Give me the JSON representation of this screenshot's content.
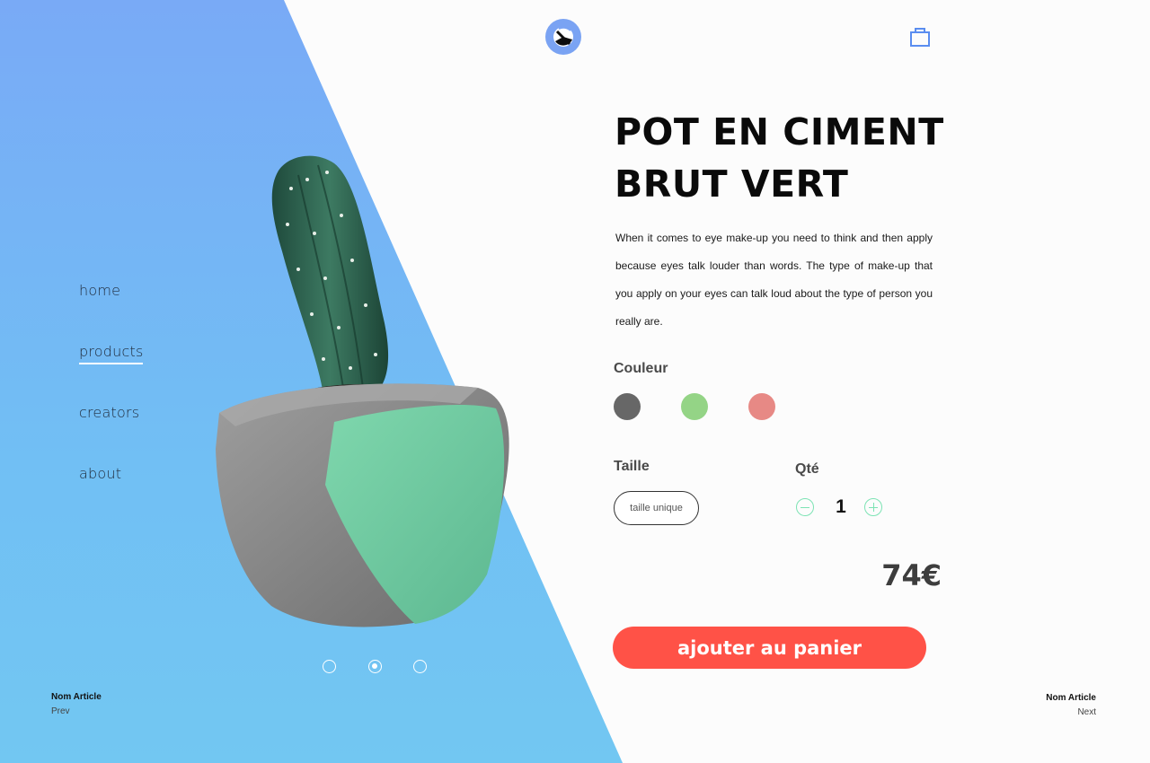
{
  "nav": {
    "items": [
      {
        "label": "home",
        "active": false
      },
      {
        "label": "products",
        "active": true
      },
      {
        "label": "creators",
        "active": false
      },
      {
        "label": "about",
        "active": false
      }
    ]
  },
  "carousel": {
    "count": 3,
    "active_index": 1
  },
  "prev": {
    "title": "Nom Article",
    "label": "Prev"
  },
  "next": {
    "title": "Nom Article",
    "label": "Next"
  },
  "product": {
    "title_line1": "POT EN CIMENT",
    "title_line2": "BRUT VERT",
    "description": "When it comes to eye make-up you need to think and then apply because eyes talk louder than words. The type of make-up that you apply on your eyes can talk loud about the type of person you really are.",
    "color_label": "Couleur",
    "colors": [
      "#676767",
      "#94d486",
      "#e78985"
    ],
    "size_label": "Taille",
    "size_value": "taille unique",
    "qty_label": "Qté",
    "qty_value": "1",
    "price": "74€",
    "cta_label": "ajouter au panier"
  },
  "icons": {
    "logo": "brand-logo-icon",
    "cart": "shopping-bag-icon"
  },
  "theme": {
    "accent": "#ff5247",
    "gradient_top": "#79aaf6",
    "gradient_bottom": "#72c7f2",
    "qty_control": "#7de3b4"
  }
}
